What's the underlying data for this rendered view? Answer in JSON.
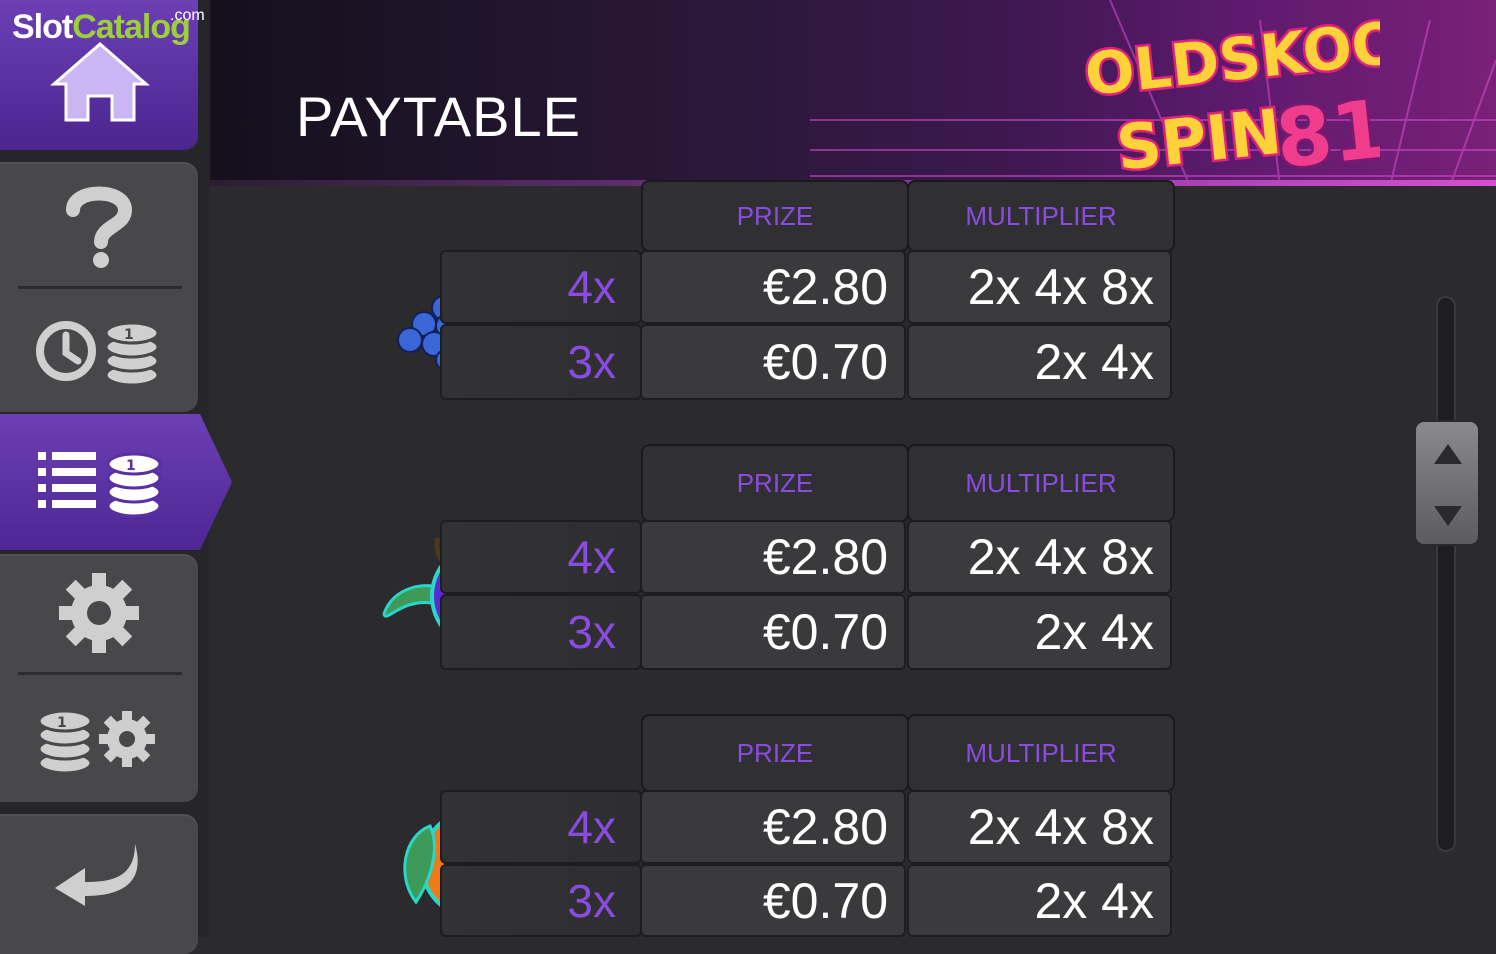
{
  "watermark": {
    "slot": "Slot",
    "catalog": "Catalog",
    "com": ".com"
  },
  "header": {
    "title": "PAYTABLE",
    "game_logo_line1": "OLDSKOOL",
    "game_logo_line2": "SPIN",
    "game_logo_number": "81"
  },
  "sidebar": {
    "items": [
      {
        "icon": "home-icon"
      },
      {
        "icon": "question-icon"
      },
      {
        "icon": "history-coins-icon"
      },
      {
        "icon": "paytable-list-coins-icon",
        "active": true
      },
      {
        "icon": "gear-icon"
      },
      {
        "icon": "coins-settings-icon"
      },
      {
        "icon": "back-arrow-icon"
      }
    ]
  },
  "paytable": {
    "columns": {
      "prize": "PRIZE",
      "multiplier": "MULTIPLIER"
    },
    "symbols": [
      {
        "name": "grapes",
        "rows": [
          {
            "count": "4x",
            "prize": "€2.80",
            "multiplier": "2x 4x 8x"
          },
          {
            "count": "3x",
            "prize": "€0.70",
            "multiplier": "2x 4x"
          }
        ]
      },
      {
        "name": "plum",
        "rows": [
          {
            "count": "4x",
            "prize": "€2.80",
            "multiplier": "2x 4x 8x"
          },
          {
            "count": "3x",
            "prize": "€0.70",
            "multiplier": "2x 4x"
          }
        ]
      },
      {
        "name": "orange",
        "rows": [
          {
            "count": "4x",
            "prize": "€2.80",
            "multiplier": "2x 4x 8x"
          },
          {
            "count": "3x",
            "prize": "€0.70",
            "multiplier": "2x 4x"
          }
        ]
      }
    ]
  },
  "colors": {
    "accent_purple": "#8a4ce0",
    "sidebar_active": "#5a2fa3",
    "panel": "#3a3a3d",
    "background": "#2b2b2d"
  }
}
